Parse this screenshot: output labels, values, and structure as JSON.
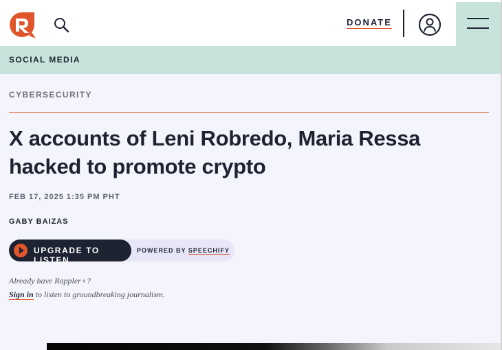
{
  "header": {
    "logo": "rappler-logo",
    "search_icon": "search-icon",
    "donate_label": "DONATE",
    "user_icon": "user-icon",
    "menu_icon": "menu-icon"
  },
  "section": {
    "label": "SOCIAL MEDIA"
  },
  "article": {
    "kicker": "CYBERSECURITY",
    "title": "X accounts of Leni Robredo, Maria Ressa hacked to promote crypto",
    "date": "FEB 17, 2025 1:35 PM PHT",
    "author": "GABY BAIZAS"
  },
  "audio": {
    "upgrade_label": "UPGRADE TO LISTEN",
    "powered_prefix": "POWERED BY ",
    "powered_brand": "SPEECHIFY"
  },
  "subscription": {
    "line1": "Already have Rappler+?",
    "signin_label": "Sign in",
    "line2_rest": " to listen to groundbreaking journalism."
  },
  "colors": {
    "brand_orange": "#e0562c",
    "mint": "#c7e3db",
    "navy": "#1d2331",
    "page_bg": "#f4f4fc"
  }
}
